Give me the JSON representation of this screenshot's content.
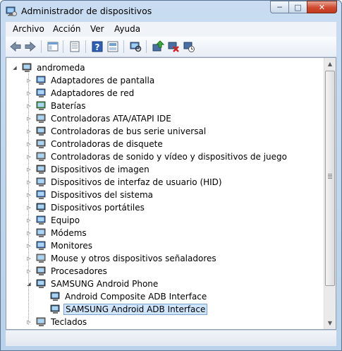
{
  "window": {
    "title": "Administrador de dispositivos",
    "controls": {
      "minimize": "─",
      "maximize": "□",
      "close": "✕"
    }
  },
  "menu": [
    "Archivo",
    "Acción",
    "Ver",
    "Ayuda"
  ],
  "toolbar": {
    "icons": [
      "back-arrow-icon",
      "forward-arrow-icon",
      "console-tree-icon",
      "properties-icon",
      "help-icon",
      "show-hidden-icon",
      "update-driver-icon",
      "uninstall-icon",
      "scan-hardware-icon"
    ]
  },
  "tree": {
    "root": "andromeda",
    "items": [
      {
        "label": "Adaptadores de pantalla",
        "icon": "display-adapter-icon"
      },
      {
        "label": "Adaptadores de red",
        "icon": "network-adapter-icon"
      },
      {
        "label": "Baterías",
        "icon": "battery-icon"
      },
      {
        "label": "Controladoras ATA/ATAPI IDE",
        "icon": "ide-controller-icon"
      },
      {
        "label": "Controladoras de bus serie universal",
        "icon": "usb-icon"
      },
      {
        "label": "Controladoras de disquete",
        "icon": "floppy-controller-icon"
      },
      {
        "label": "Controladoras de sonido y vídeo y dispositivos de juego",
        "icon": "sound-icon"
      },
      {
        "label": "Dispositivos de imagen",
        "icon": "camera-icon"
      },
      {
        "label": "Dispositivos de interfaz de usuario (HID)",
        "icon": "hid-icon"
      },
      {
        "label": "Dispositivos del sistema",
        "icon": "system-device-icon"
      },
      {
        "label": "Dispositivos portátiles",
        "icon": "portable-device-icon"
      },
      {
        "label": "Equipo",
        "icon": "computer-icon"
      },
      {
        "label": "Módems",
        "icon": "modem-icon"
      },
      {
        "label": "Monitores",
        "icon": "monitor-icon"
      },
      {
        "label": "Mouse y otros dispositivos señaladores",
        "icon": "mouse-icon"
      },
      {
        "label": "Procesadores",
        "icon": "processor-icon"
      },
      {
        "label": "SAMSUNG Android Phone",
        "icon": "phone-device-icon",
        "expanded": true,
        "children": [
          {
            "label": "Android Composite ADB Interface",
            "icon": "adb-interface-icon"
          },
          {
            "label": "SAMSUNG Android ADB Interface",
            "icon": "adb-interface-icon",
            "selected": true
          }
        ]
      },
      {
        "label": "Teclados",
        "icon": "keyboard-icon"
      }
    ]
  },
  "colors": {
    "frame": "#c9dcf1",
    "selection_bg": "#cfe5fb",
    "selection_border": "#7da2ce",
    "close_button": "#cf4a30"
  }
}
